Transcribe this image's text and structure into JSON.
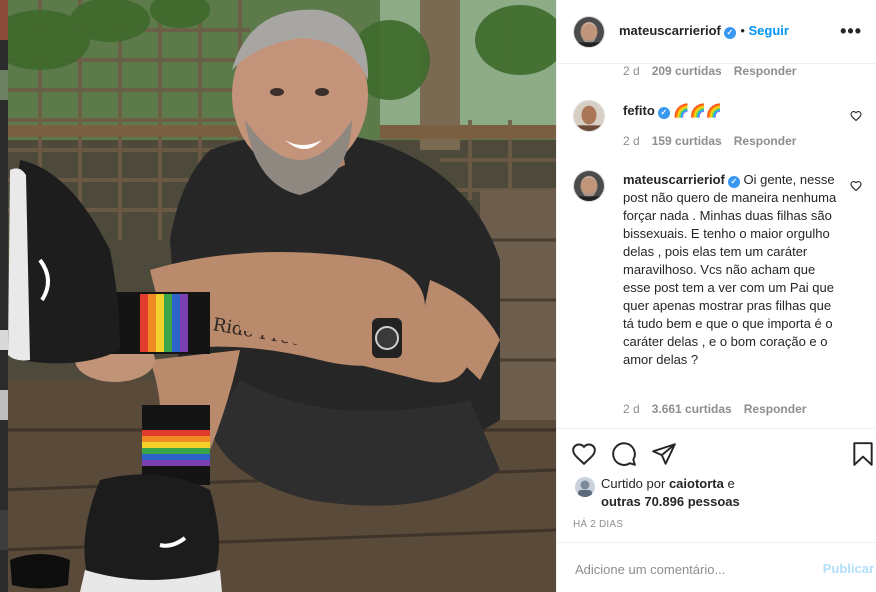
{
  "post": {
    "author": "mateuscarrieriof",
    "follow_label": "Seguir",
    "more_label": "•••"
  },
  "comments": [
    {
      "time": "2 d",
      "likes": "209 curtidas",
      "reply": "Responder"
    },
    {
      "user": "fefito",
      "text": "🌈🌈🌈",
      "time": "2 d",
      "likes": "159 curtidas",
      "reply": "Responder"
    },
    {
      "user": "mateuscarrieriof",
      "text": "Oi gente, nesse post não quero de maneira nenhuma forçar nada . Minhas duas filhas são bissexuais. E tenho o maior orgulho delas , pois elas tem um caráter maravilhoso. Vcs não acham que esse post tem a ver com um Pai que quer apenas mostrar pras filhas que tá tudo bem e que o que importa é o caráter delas , e o bom coração e o amor delas ?",
      "time": "2 d",
      "likes": "3.661 curtidas",
      "reply": "Responder"
    }
  ],
  "likes_summary": {
    "prefix": "Curtido por",
    "user": "caiotorta",
    "mid": "e",
    "others": "outras 70.896 pessoas"
  },
  "time_ago": "HÁ 2 DIAS",
  "add_comment": {
    "placeholder": "Adicione um comentário...",
    "publish_label": "Publicar"
  },
  "colors": {
    "accent": "#0095f6",
    "verified": "#3897f0",
    "muted": "#8e8e8e",
    "publish_disabled": "#b2dffc"
  },
  "icons": [
    "like-icon",
    "comment-icon",
    "share-icon",
    "save-icon",
    "verified-badge-icon",
    "more-options-icon"
  ]
}
